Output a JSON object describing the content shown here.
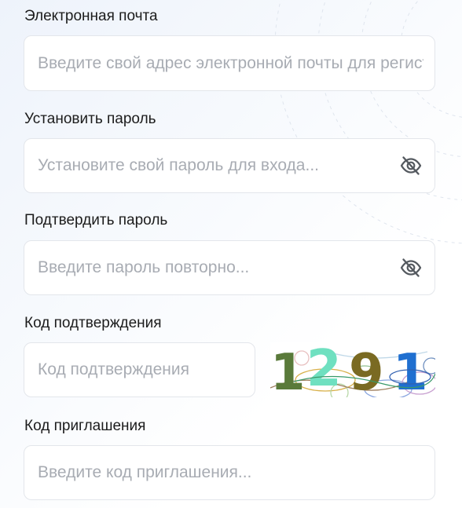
{
  "form": {
    "email": {
      "label": "Электронная почта",
      "placeholder": "Введите свой адрес электронной почты для регистрации"
    },
    "password": {
      "label": "Установить пароль",
      "placeholder": "Установите свой пароль для входа...",
      "toggle_icon": "eye-off-icon"
    },
    "confirm_password": {
      "label": "Подтвердить пароль",
      "placeholder": "Введите пароль повторно...",
      "toggle_icon": "eye-off-icon"
    },
    "verification": {
      "label": "Код подтверждения",
      "placeholder": "Код подтверждения",
      "captcha_chars": [
        "1",
        "2",
        "9",
        "1"
      ],
      "captcha_colors": [
        "#5a7a3a",
        "#6fe0c0",
        "#7a6a22",
        "#1f6fd0"
      ]
    },
    "invite": {
      "label": "Код приглашения",
      "placeholder": "Введите код приглашения..."
    }
  },
  "colors": {
    "label_text": "#1c1c1c",
    "placeholder_text": "#a8acb3",
    "input_border": "#e3e6eb",
    "icon": "#555a60"
  }
}
